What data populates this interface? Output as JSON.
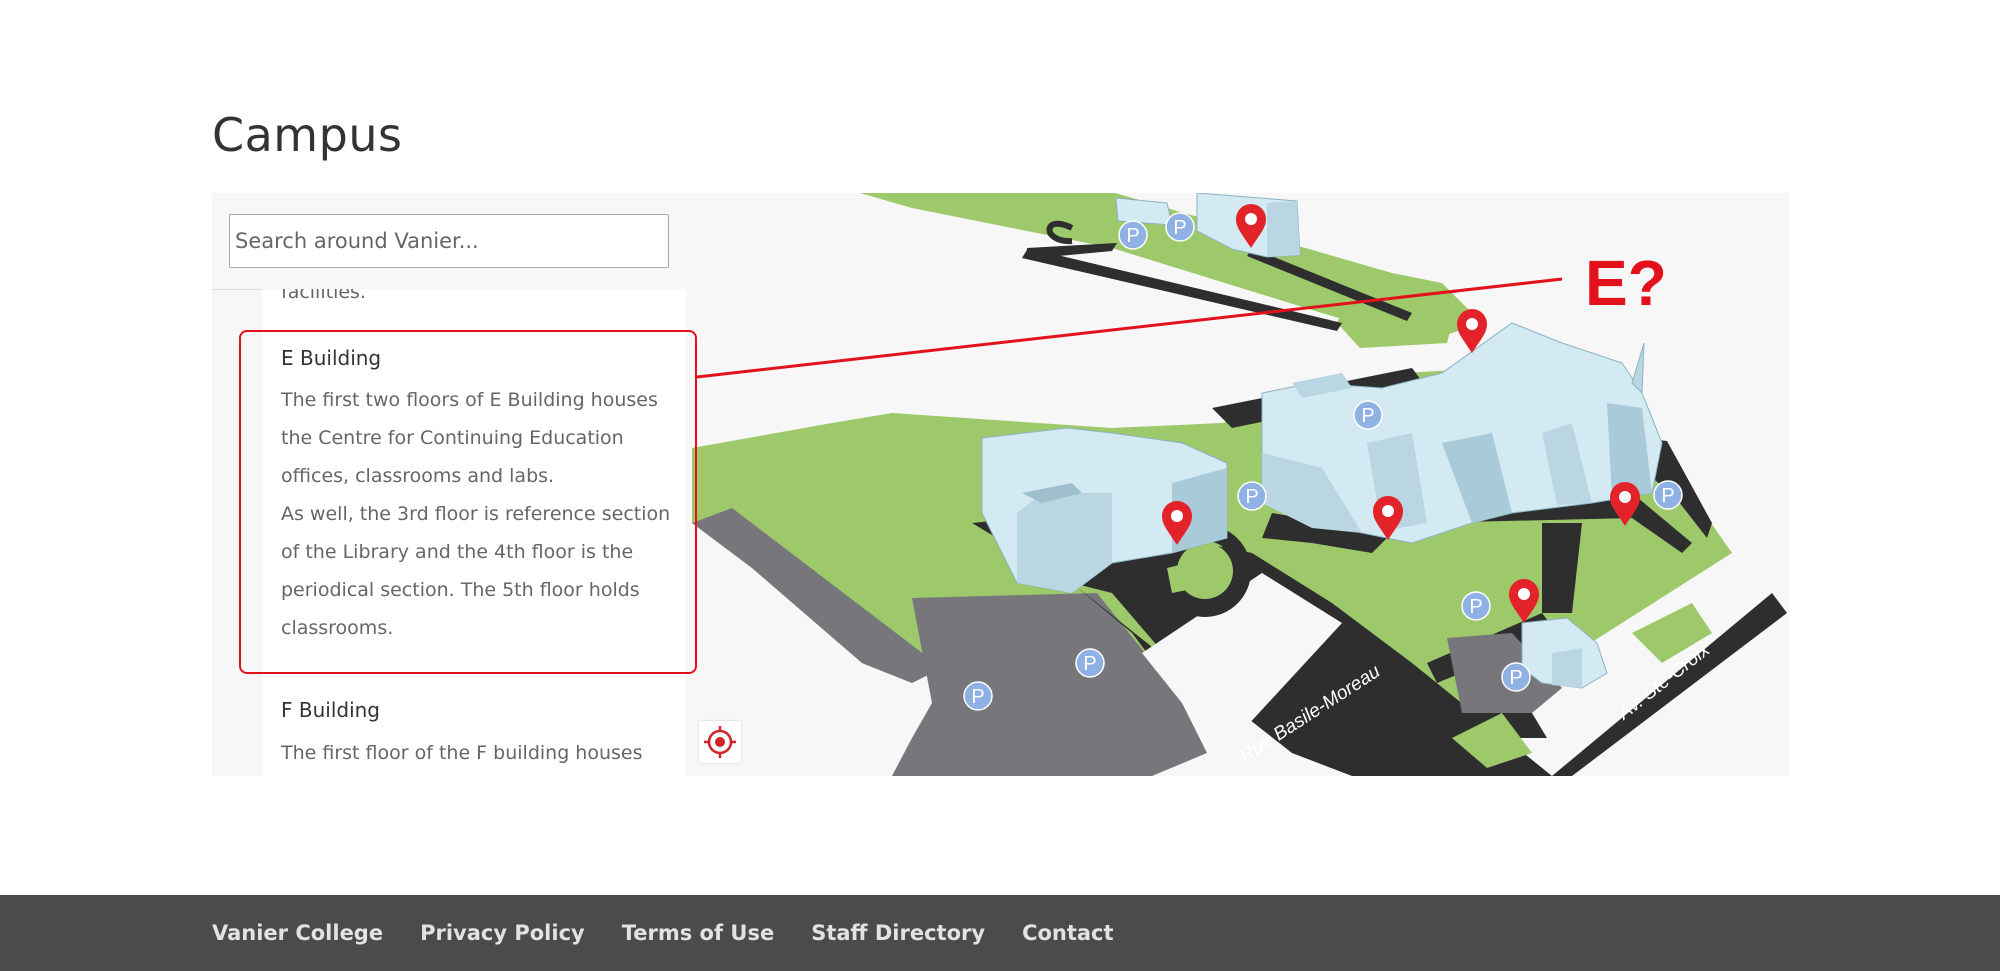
{
  "page": {
    "title": "Campus"
  },
  "search": {
    "placeholder": "Search around Vanier..."
  },
  "list": {
    "previous_cut_text": "facilities.",
    "items": [
      {
        "title": "E Building",
        "desc": [
          "The first two floors of E Building houses the Centre for Continuing Education offices, classrooms and labs.",
          "As well, the 3rd floor is reference section of the Library and the 4th floor is the periodical section. The 5th floor holds classrooms."
        ]
      },
      {
        "title": "F Building",
        "desc": [
          "The first floor of the F building houses the"
        ]
      }
    ]
  },
  "map": {
    "annotation": "E?",
    "streets": [
      "Rue Basile-Moreau",
      "Av. Ste-Croix"
    ],
    "parking_symbol": "P",
    "colors": {
      "lawn": "#9dc96a",
      "road": "#2e2e2e",
      "building": "#d3eaf3",
      "parking_lot": "#77767b",
      "marker": "#e3232a",
      "parking": "#8fb1e3",
      "annotation": "#e3111b"
    }
  },
  "footer": {
    "links": [
      "Vanier College",
      "Privacy Policy",
      "Terms of Use",
      "Staff Directory",
      "Contact"
    ]
  }
}
